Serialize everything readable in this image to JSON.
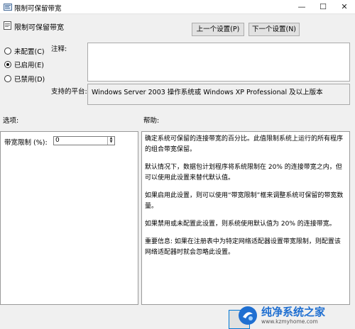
{
  "window": {
    "title": "限制可保留带宽",
    "minimize_glyph": "—",
    "maximize_glyph": "☐",
    "close_glyph": "✕"
  },
  "policy_name": "限制可保留带宽",
  "nav": {
    "prev_label": "上一个设置(P)",
    "next_label": "下一个设置(N)"
  },
  "state": {
    "options": [
      {
        "label": "未配置(C)",
        "selected": false
      },
      {
        "label": "已启用(E)",
        "selected": true
      },
      {
        "label": "已禁用(D)",
        "selected": false
      }
    ]
  },
  "comment": {
    "label": "注释:",
    "value": ""
  },
  "supported": {
    "label": "支持的平台:",
    "value": "Windows Server 2003 操作系统或 Windows XP Professional 及以上版本"
  },
  "options_pane": {
    "header": "选项:",
    "bandwidth_label": "带宽限制 (%):",
    "bandwidth_value": "0"
  },
  "help_pane": {
    "header": "帮助:",
    "paragraphs": [
      "确定系统可保留的连接带宽的百分比。此值限制系统上运行的所有程序的组合带宽保留。",
      "默认情况下，数据包计划程序将系统限制在 20% 的连接带宽之内，但可以使用此设置来替代默认值。",
      "如果启用此设置，则可以使用“带宽限制”框来调整系统可保留的带宽数量。",
      "如果禁用或未配置此设置，则系统使用默认值为 20% 的连接带宽。",
      "重要信息: 如果在注册表中为特定网络适配器设置带宽限制，则配置该网络适配器时就会忽略此设置。"
    ]
  },
  "watermark": {
    "brand": "纯净系统之家",
    "url": "www.kzmyhome.com"
  },
  "colors": {
    "accent": "#0078d7",
    "watermark_blue": "#1f6fd1"
  }
}
